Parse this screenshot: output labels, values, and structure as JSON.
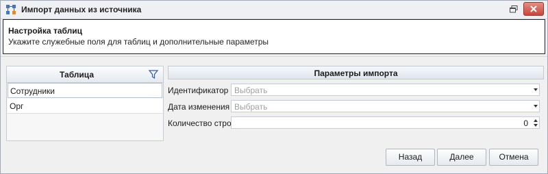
{
  "window": {
    "title": "Импорт данных из источника"
  },
  "header": {
    "title": "Настройка таблиц",
    "subtitle": "Укажите служебные поля для таблиц и дополнительные параметры"
  },
  "tables": {
    "column_header": "Таблица",
    "rows": [
      {
        "label": "Сотрудники",
        "selected": true
      },
      {
        "label": "Орг",
        "selected": false
      }
    ]
  },
  "params": {
    "title": "Параметры импорта",
    "identifier": {
      "label": "Идентификатор",
      "placeholder": "Выбрать"
    },
    "modified_date": {
      "label": "Дата изменения",
      "placeholder": "Выбрать"
    },
    "row_count": {
      "label": "Количество строк",
      "value": "0"
    }
  },
  "buttons": {
    "back": "Назад",
    "next": "Далее",
    "cancel": "Отмена"
  },
  "colors": {
    "close_button": "#c9463a",
    "panel_border": "#c6ccd4"
  }
}
